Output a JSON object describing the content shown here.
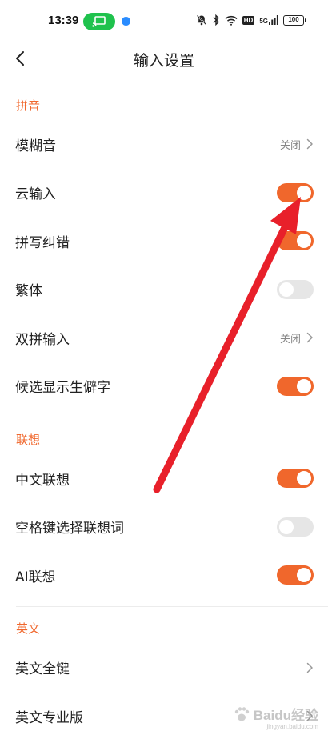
{
  "status_bar": {
    "time": "13:39",
    "battery": "100",
    "hd_label": "HD",
    "network_label": "5G"
  },
  "header": {
    "title": "输入设置"
  },
  "sections": [
    {
      "title": "拼音",
      "rows": [
        {
          "label": "模糊音",
          "type": "link",
          "value": "关闭"
        },
        {
          "label": "云输入",
          "type": "switch",
          "on": true
        },
        {
          "label": "拼写纠错",
          "type": "switch",
          "on": true
        },
        {
          "label": "繁体",
          "type": "switch",
          "on": false
        },
        {
          "label": "双拼输入",
          "type": "link",
          "value": "关闭"
        },
        {
          "label": "候选显示生僻字",
          "type": "switch",
          "on": true
        }
      ]
    },
    {
      "title": "联想",
      "rows": [
        {
          "label": "中文联想",
          "type": "switch",
          "on": true
        },
        {
          "label": "空格键选择联想词",
          "type": "switch",
          "on": false
        },
        {
          "label": "AI联想",
          "type": "switch",
          "on": true
        }
      ]
    },
    {
      "title": "英文",
      "rows": [
        {
          "label": "英文全键",
          "type": "link",
          "value": ""
        },
        {
          "label": "英文专业版",
          "type": "link",
          "value": ""
        }
      ]
    }
  ],
  "colors": {
    "accent": "#f0672c",
    "annotation_arrow": "#e8202a",
    "switch_off": "#e6e6e6"
  },
  "watermark": {
    "text": "Baidu经验",
    "sub": "jingyan.baidu.com"
  }
}
